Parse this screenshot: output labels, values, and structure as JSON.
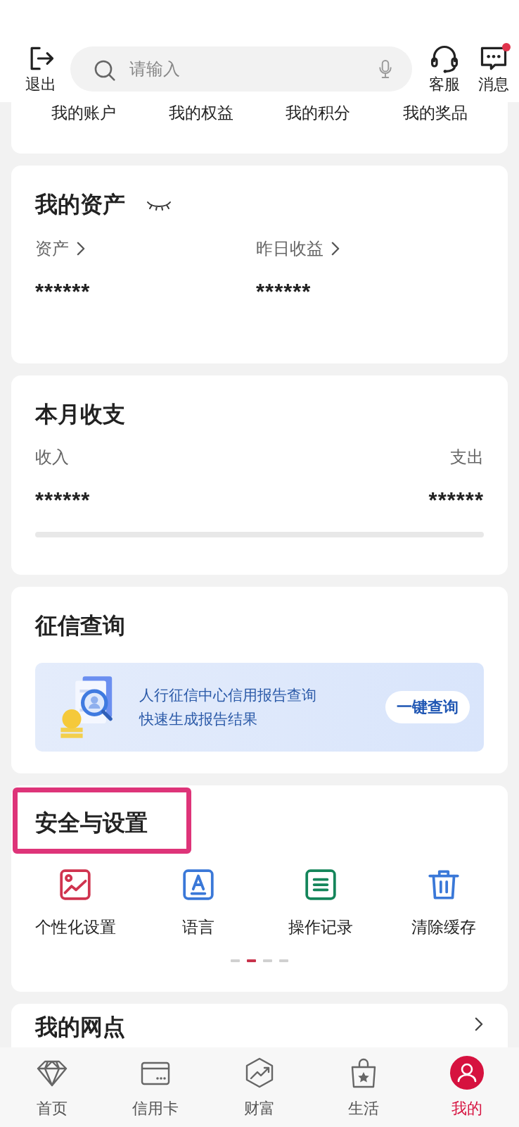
{
  "header": {
    "logout": "退出",
    "search": {
      "placeholder": "请输入"
    },
    "actions": [
      {
        "label": "客服",
        "kind": "headset",
        "badge": false
      },
      {
        "label": "消息",
        "kind": "message",
        "badge": true
      }
    ]
  },
  "account_links": [
    "我的账户",
    "我的权益",
    "我的积分",
    "我的奖品"
  ],
  "assets": {
    "title": "我的资产",
    "hidden": true,
    "items": [
      {
        "label": "资产",
        "value": "******"
      },
      {
        "label": "昨日收益",
        "value": "******"
      }
    ]
  },
  "monthly": {
    "title": "本月收支",
    "income": {
      "label": "收入",
      "value": "******"
    },
    "expense": {
      "label": "支出",
      "value": "******"
    }
  },
  "credit": {
    "title": "征信查询",
    "banner": {
      "lines": [
        "人行征信中心信用报告查询",
        "快速生成报告结果"
      ],
      "button": "一键查询"
    }
  },
  "settings": {
    "title": "安全与设置",
    "highlighted": true,
    "items": [
      {
        "label": "个性化设置",
        "kind": "picture",
        "color": "#d0344f"
      },
      {
        "label": "语言",
        "kind": "language",
        "color": "#3a78d8"
      },
      {
        "label": "操作记录",
        "kind": "log",
        "color": "#14855a"
      },
      {
        "label": "清除缓存",
        "kind": "trash",
        "color": "#3a78d8"
      }
    ],
    "pages": [
      {
        "selected": false
      },
      {
        "selected": true
      },
      {
        "selected": false
      },
      {
        "selected": false
      }
    ]
  },
  "branches": {
    "title": "我的网点"
  },
  "tabs": [
    {
      "label": "首页",
      "kind": "diamond",
      "selected": false
    },
    {
      "label": "信用卡",
      "kind": "card",
      "selected": false
    },
    {
      "label": "财富",
      "kind": "chart",
      "selected": false
    },
    {
      "label": "生活",
      "kind": "bag",
      "selected": false
    },
    {
      "label": "我的",
      "kind": "user",
      "selected": true
    }
  ]
}
